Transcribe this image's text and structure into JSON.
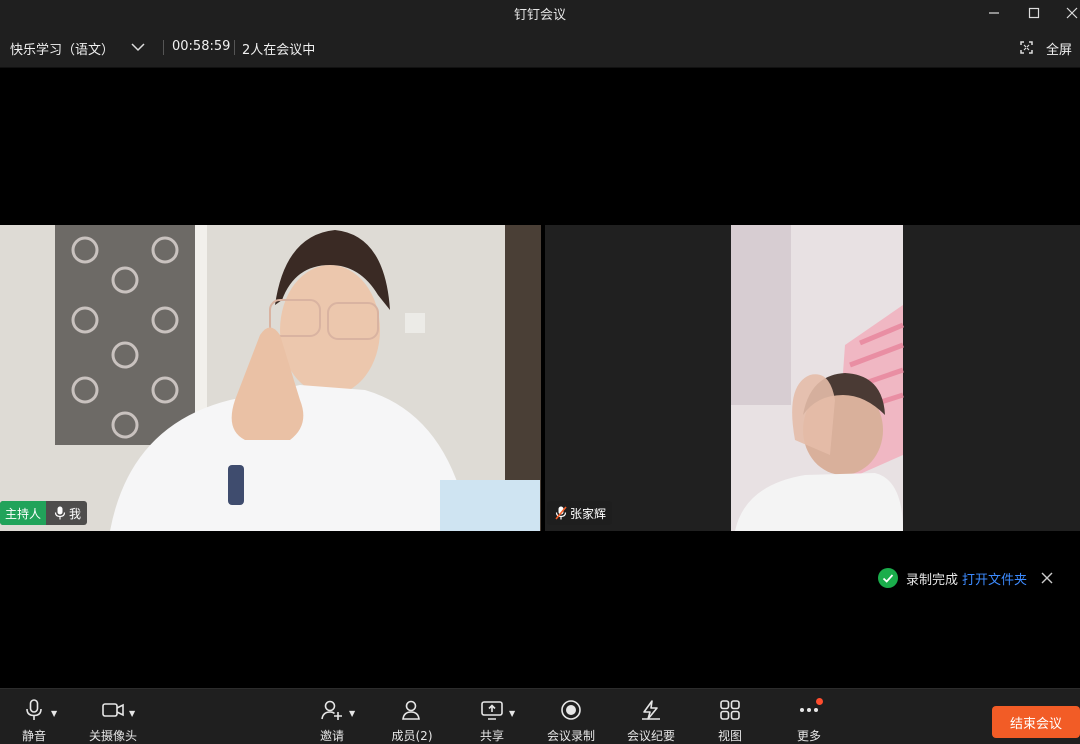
{
  "window": {
    "title": "钉钉会议"
  },
  "info_bar": {
    "meeting_name": "快乐学习（语文）",
    "duration": "00:58:59",
    "participant_status": "2人在会议中",
    "fullscreen_label": "全屏"
  },
  "participants": [
    {
      "host_badge": "主持人",
      "name": "我",
      "mic": "on"
    },
    {
      "name": "张家辉",
      "mic": "muted"
    }
  ],
  "toast": {
    "message": "录制完成",
    "link": "打开文件夹"
  },
  "toolbar": {
    "mute": "静音",
    "camera_off": "关摄像头",
    "invite": "邀请",
    "members": "成员(2)",
    "share": "共享",
    "record": "会议录制",
    "minutes": "会议纪要",
    "view": "视图",
    "more": "更多",
    "end_meeting": "结束会议"
  },
  "colors": {
    "accent_link": "#3d8bff",
    "host_badge": "#21a35a",
    "end_button": "#f25c26",
    "success": "#1aad4b",
    "notify_dot": "#ff4d2e"
  },
  "icons": {
    "toolbar": [
      "microphone-icon",
      "video-camera-icon",
      "add-person-icon",
      "people-icon",
      "screen-share-icon",
      "record-icon",
      "ai-minutes-icon",
      "grid-view-icon",
      "more-dots-icon"
    ],
    "window": [
      "minimize-icon",
      "maximize-icon",
      "close-icon"
    ]
  }
}
